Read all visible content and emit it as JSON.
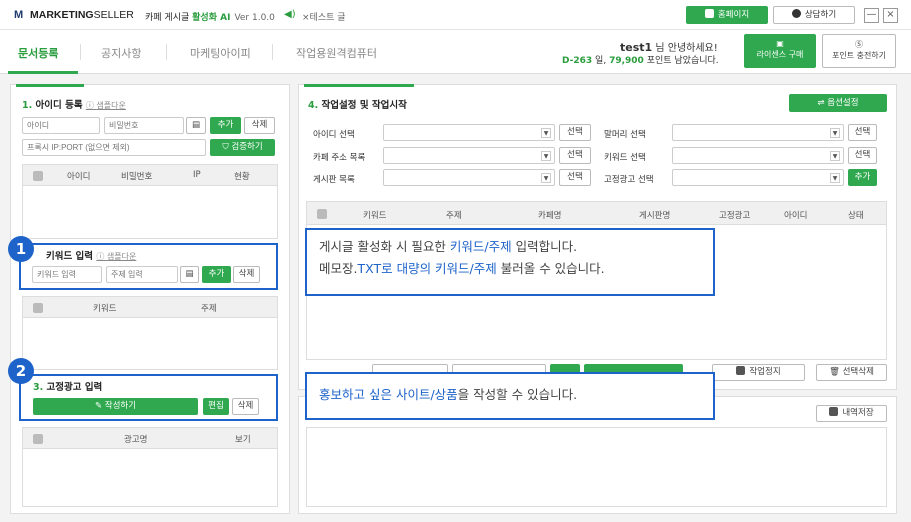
{
  "titlebar": {
    "logo_letter": "M",
    "brand_bold": "MARKETING",
    "brand_rest": "SELLER",
    "app_name": "카페 게시글",
    "app_highlight": "활성화 AI",
    "version": "Ver 1.0.0",
    "notice": "×테스트 글",
    "homepage_label": "홈페이지",
    "consult_label": "상담하기",
    "minimize": "—",
    "close": "×"
  },
  "nav": {
    "tabs": [
      "문서등록",
      "공지사항",
      "마케팅아이피",
      "작업용원격컴퓨터"
    ],
    "active_tab": 0,
    "user_id": "test1",
    "greeting": "님 안녕하세요!",
    "dday": "D-263",
    "dday_unit": "일,",
    "points": "79,900",
    "points_suffix": "포인트 남았습니다.",
    "license_btn": "라이센스 구매",
    "point_btn": "포인트 충전하기"
  },
  "sec1": {
    "num": "1.",
    "title": "아이디 등록",
    "sample": "샘플다운",
    "id_placeholder": "아이디",
    "pw_placeholder": "비밀번호",
    "add": "추가",
    "delete": "삭제",
    "proxy_placeholder": "프록시 IP:PORT (없으면 제외)",
    "verify": "검증하기",
    "columns": [
      "아이디",
      "비밀번호",
      "IP",
      "현황"
    ]
  },
  "sec2": {
    "num": "2.",
    "title": "키워드 입력",
    "sample": "샘플다운",
    "kw_placeholder": "키워드 입력",
    "topic_placeholder": "주제 입력",
    "add": "추가",
    "delete": "삭제",
    "columns": [
      "키워드",
      "주제"
    ]
  },
  "sec3": {
    "num": "3.",
    "title": "고정광고 입력",
    "write": "작성하기",
    "edit": "편집",
    "delete": "삭제",
    "columns": [
      "광고명",
      "보기"
    ]
  },
  "sec4": {
    "num": "4.",
    "title": "작업설정 및 작업시작",
    "options_btn": "옵션설정",
    "rows_left": [
      "아이디 선택",
      "카페 주소 목록",
      "게시판 목록"
    ],
    "rows_right": [
      "말머리 선택",
      "키워드 선택",
      "고정광고 선택"
    ],
    "select_label": "선택",
    "add_label": "추가",
    "columns": [
      "키워드",
      "주제",
      "카페명",
      "게시판명",
      "고정광고",
      "아이디",
      "상태"
    ],
    "stop_btn": "작업정지",
    "delete_sel_btn": "선택삭제",
    "save_btn": "내역저장"
  },
  "callouts": {
    "c1_line1_pre": "게시글 활성화 시 필요한 ",
    "c1_line1_hl": "키워드/주제",
    "c1_line1_post": " 입력합니다.",
    "c1_line2_pre": "메모장.",
    "c1_line2_hl": "TXT로 대량의 키워드/주제",
    "c1_line2_post": " 불러올 수 있습니다.",
    "c2_hl": "홍보하고 싶은 사이트/상품",
    "c2_post": "을 작성할 수 있습니다.",
    "badge1": "1",
    "badge2": "2"
  },
  "colors": {
    "green": "#2fa84f",
    "blue": "#1e63c9"
  }
}
